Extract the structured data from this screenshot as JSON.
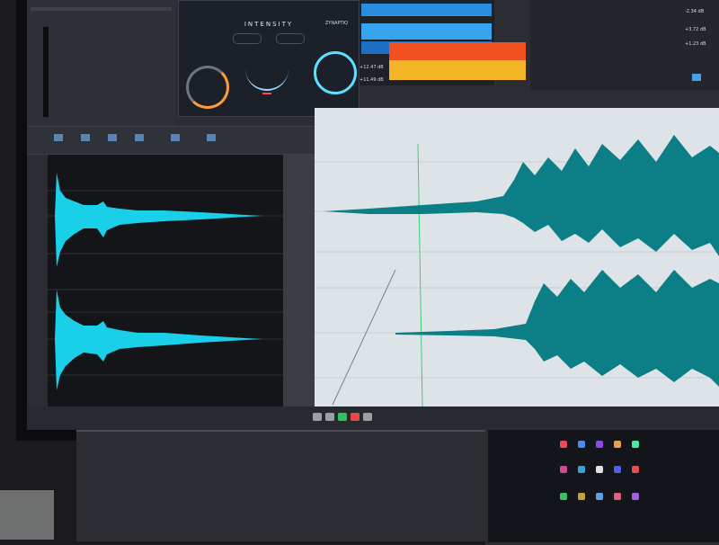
{
  "plugin": {
    "title": "INTENSITY",
    "brand": "ZYNAPTIQ"
  },
  "meters": {
    "readouts": [
      "-2.34 dB",
      "+3.72 dB",
      "+1.23 dB",
      "+12.47 dB",
      "+11.49 dB"
    ]
  },
  "colors": {
    "waveform_left": "#1ad0e8",
    "waveform_right": "#0c7f86",
    "meter_orange": "#f0511e",
    "meter_yellow": "#f4b626",
    "meter_blue": "#2b8de0"
  }
}
